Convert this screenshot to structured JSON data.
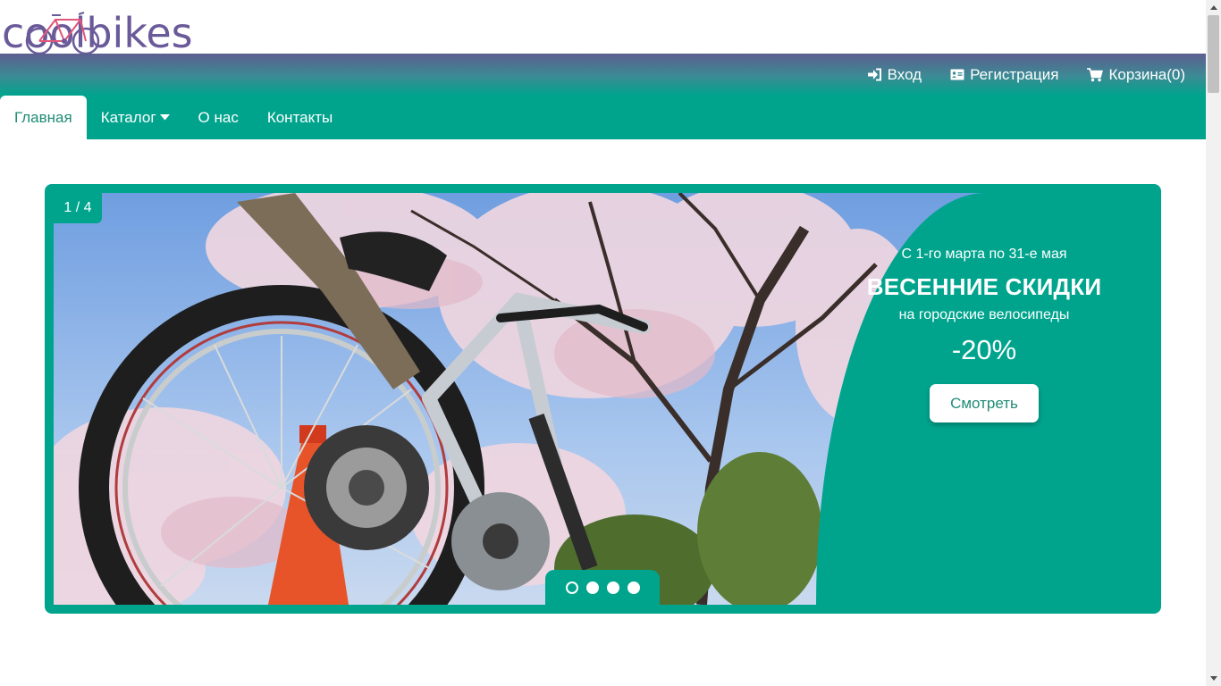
{
  "brand": {
    "logo_text": "coolbikes",
    "logo_color": "#6b5a99"
  },
  "topnav": {
    "login_label": "Вход",
    "login_icon": "sign-in-icon",
    "register_label": "Регистрация",
    "register_icon": "id-card-icon",
    "cart_label": "Корзина(0)",
    "cart_icon": "shopping-cart-icon"
  },
  "mainnav": {
    "items": [
      {
        "label": "Главная",
        "active": true
      },
      {
        "label": "Каталог",
        "active": false,
        "icon": "caret-down-icon"
      },
      {
        "label": "О нас",
        "active": false
      },
      {
        "label": "Контакты",
        "active": false
      }
    ]
  },
  "slider": {
    "counter": "1 / 4",
    "current_slide": 1,
    "total_slides": 4,
    "promo": {
      "pretitle": "С 1-го марта по 31-е мая",
      "title": "ВЕСЕННИЕ СКИДКИ",
      "subtitle": "на городские велосипеды",
      "discount": "-20%",
      "button_label": "Смотреть"
    }
  },
  "colors": {
    "accent": "#00a48d",
    "accent_text": "#1f8c76",
    "topbar_gradient_start": "#5c5e8f"
  }
}
